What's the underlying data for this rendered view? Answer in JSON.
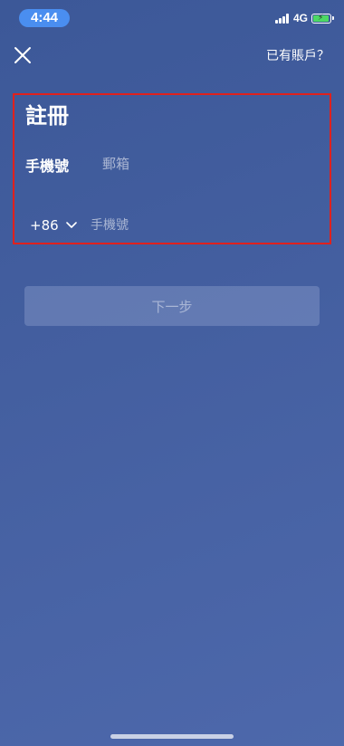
{
  "status_bar": {
    "time": "4:44",
    "network": "4G",
    "battery_level": 0.85,
    "battery_color": "#4cd964"
  },
  "header": {
    "close_icon": "close-icon",
    "login_link": "已有賬戶？"
  },
  "form": {
    "title": "註冊",
    "tabs": [
      {
        "label": "手機號",
        "active": true
      },
      {
        "label": "郵箱",
        "active": false
      }
    ],
    "country_code": "+86",
    "phone_placeholder": "手機號"
  },
  "next_button": "下一步",
  "colors": {
    "background": "#445fa0",
    "highlight_border": "#e0211d",
    "time_pill": "#4a8ef0"
  }
}
